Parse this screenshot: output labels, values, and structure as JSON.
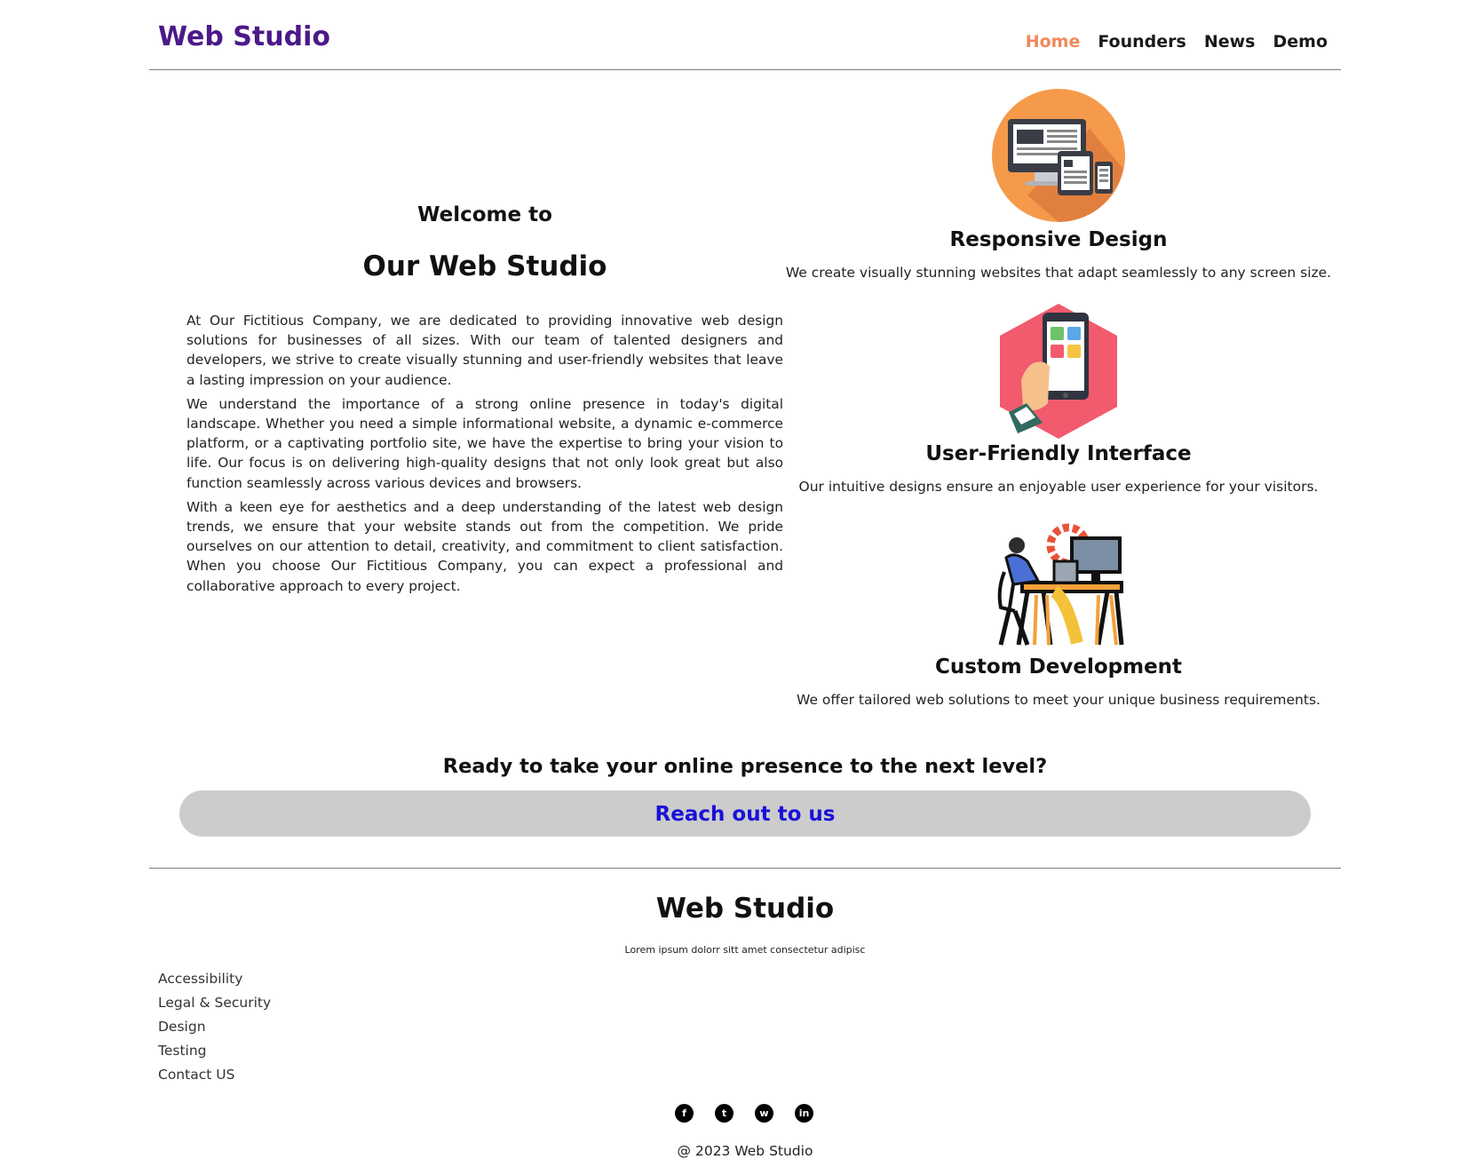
{
  "header": {
    "brand": "Web Studio",
    "nav": [
      {
        "label": "Home",
        "active": true
      },
      {
        "label": "Founders",
        "active": false
      },
      {
        "label": "News",
        "active": false
      },
      {
        "label": "Demo",
        "active": false
      }
    ]
  },
  "hero": {
    "welcome_small": "Welcome to",
    "welcome_big": "Our Web Studio",
    "paragraphs": [
      "At Our Fictitious Company, we are dedicated to providing innovative web design solutions for businesses of all sizes. With our team of talented designers and developers, we strive to create visually stunning and user-friendly websites that leave a lasting impression on your audience.",
      "We understand the importance of a strong online presence in today's digital landscape. Whether you need a simple informational website, a dynamic e-commerce platform, or a captivating portfolio site, we have the expertise to bring your vision to life. Our focus is on delivering high-quality designs that not only look great but also function seamlessly across various devices and browsers.",
      "With a keen eye for aesthetics and a deep understanding of the latest web design trends, we ensure that your website stands out from the competition. We pride ourselves on our attention to detail, creativity, and commitment to client satisfaction. When you choose Our Fictitious Company, you can expect a professional and collaborative approach to every project."
    ]
  },
  "features": [
    {
      "icon": "responsive-devices-icon",
      "title": "Responsive Design",
      "text": "We create visually stunning websites that adapt seamlessly to any screen size."
    },
    {
      "icon": "smartphone-apps-icon",
      "title": "User-Friendly Interface",
      "text": "Our intuitive designs ensure an enjoyable user experience for your visitors."
    },
    {
      "icon": "developer-desk-icon",
      "title": "Custom Development",
      "text": "We offer tailored web solutions to meet your unique business requirements."
    }
  ],
  "cta": {
    "title": "Ready to take your online presence to the next level?",
    "button": "Reach out to us"
  },
  "footer": {
    "brand": "Web Studio",
    "tagline": "Lorem ipsum dolorr sitt amet consectetur adipisc",
    "links": [
      "Accessibility",
      "Legal & Security",
      "Design",
      "Testing",
      "Contact US"
    ],
    "social": [
      {
        "icon": "facebook-icon",
        "glyph": "f"
      },
      {
        "icon": "twitter-icon",
        "glyph": "t"
      },
      {
        "icon": "whatsapp-icon",
        "glyph": "w"
      },
      {
        "icon": "linkedin-icon",
        "glyph": "in"
      }
    ],
    "copyright": "@ 2023 Web Studio"
  },
  "colors": {
    "brand": "#4b1a88",
    "nav_active": "#ee8a5a",
    "cta_background": "#cccccc",
    "cta_text": "#1a10d8"
  }
}
